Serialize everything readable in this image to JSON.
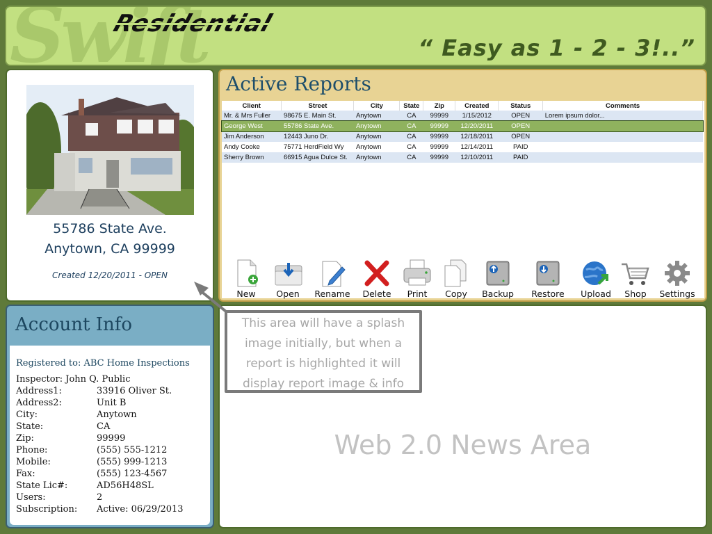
{
  "header": {
    "watermark": "Swift",
    "brand": "Residential",
    "tagline": "“ Easy as 1 - 2 - 3!..”"
  },
  "property": {
    "address_line1": "55786 State Ave.",
    "address_line2": "Anytown, CA 99999",
    "created": "Created 12/20/2011 - OPEN"
  },
  "reports": {
    "title": "Active Reports",
    "columns": [
      "Client",
      "Street",
      "City",
      "State",
      "Zip",
      "Created",
      "Status",
      "Comments"
    ],
    "rows": [
      {
        "client": "Mr. & Mrs Fuller",
        "street": "98675 E. Main St.",
        "city": "Anytown",
        "state": "CA",
        "zip": "99999",
        "created": "1/15/2012",
        "status": "OPEN",
        "comments": "Lorem ipsum dolor..."
      },
      {
        "client": "George West",
        "street": "55786 State Ave.",
        "city": "Anytown",
        "state": "CA",
        "zip": "99999",
        "created": "12/20/2011",
        "status": "OPEN",
        "comments": ""
      },
      {
        "client": "Jim Anderson",
        "street": "12443 Juno Dr.",
        "city": "Anytown",
        "state": "CA",
        "zip": "99999",
        "created": "12/18/2011",
        "status": "OPEN",
        "comments": ""
      },
      {
        "client": "Andy Cooke",
        "street": "75771 HerdField Wy",
        "city": "Anytown",
        "state": "CA",
        "zip": "99999",
        "created": "12/14/2011",
        "status": "PAID",
        "comments": ""
      },
      {
        "client": "Sherry Brown",
        "street": "66915 Agua Dulce St.",
        "city": "Anytown",
        "state": "CA",
        "zip": "99999",
        "created": "12/10/2011",
        "status": "PAID",
        "comments": ""
      }
    ],
    "selected_index": 1
  },
  "toolbar": {
    "new": "New",
    "open": "Open",
    "rename": "Rename",
    "delete": "Delete",
    "print": "Print",
    "copy": "Copy",
    "backup": "Backup",
    "restore": "Restore",
    "upload": "Upload",
    "shop": "Shop",
    "settings": "Settings"
  },
  "account": {
    "title": "Account Info",
    "registered_to": "Registered to: ABC Home Inspections",
    "inspector": "Inspector: John Q. Public",
    "fields": [
      {
        "label": "Address1:",
        "value": "33916 Oliver St."
      },
      {
        "label": "Address2:",
        "value": "Unit B"
      },
      {
        "label": "City:",
        "value": "Anytown"
      },
      {
        "label": "State:",
        "value": "CA"
      },
      {
        "label": "Zip:",
        "value": "99999"
      },
      {
        "label": "Phone:",
        "value": "(555) 555-1212"
      },
      {
        "label": "Mobile:",
        "value": "(555) 999-1213"
      },
      {
        "label": "Fax:",
        "value": "(555) 123-4567"
      },
      {
        "label": "State Lic#:",
        "value": "AD56H48SL"
      },
      {
        "label": "Users:",
        "value": "2"
      },
      {
        "label": "Subscription:",
        "value": "Active: 06/29/2013"
      }
    ]
  },
  "news": {
    "heading": "Web 2.0 News Area"
  },
  "annotation": {
    "lines": [
      "This area will have a splash",
      "image initially, but when a",
      "report is highlighted it will",
      "display report image & info"
    ]
  },
  "colors": {
    "header_bg": "#c2e081",
    "reports_bg": "#e8d394",
    "account_bg": "#7aaec5",
    "selected_row": "#8fb25e",
    "title_text": "#1d4e6b"
  }
}
